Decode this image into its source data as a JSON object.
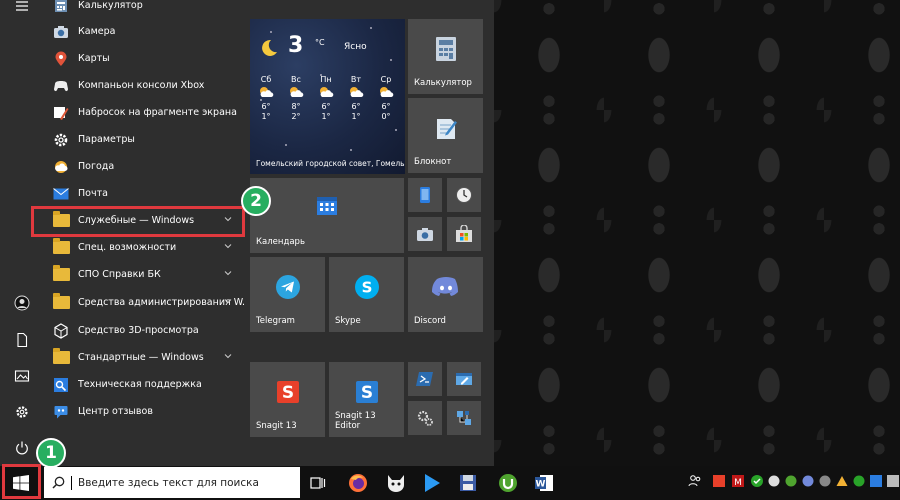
{
  "apps": [
    {
      "label": "Калькулятор",
      "icon": "calculator-icon"
    },
    {
      "label": "Камера",
      "icon": "camera-icon"
    },
    {
      "label": "Карты",
      "icon": "maps-pin-icon"
    },
    {
      "label": "Компаньон консоли Xbox",
      "icon": "xbox-icon"
    },
    {
      "label": "Набросок на фрагменте экрана",
      "icon": "snip-sketch-icon"
    },
    {
      "label": "Параметры",
      "icon": "gear-icon"
    },
    {
      "label": "Погода",
      "icon": "weather-icon"
    },
    {
      "label": "Почта",
      "icon": "mail-icon"
    },
    {
      "label": "Служебные — Windows",
      "icon": "folder-icon",
      "expandable": true
    },
    {
      "label": "Спец. возможности",
      "icon": "folder-icon",
      "expandable": true
    },
    {
      "label": "СПО Справки БК",
      "icon": "folder-icon",
      "expandable": true
    },
    {
      "label": "Средства администрирования W...",
      "icon": "folder-icon",
      "expandable": true
    },
    {
      "label": "Средство 3D-просмотра",
      "icon": "3d-viewer-icon"
    },
    {
      "label": "Стандартные — Windows",
      "icon": "folder-icon",
      "expandable": true
    },
    {
      "label": "Техническая поддержка",
      "icon": "support-icon"
    },
    {
      "label": "Центр отзывов",
      "icon": "feedback-hub-icon"
    }
  ],
  "weather": {
    "temp": "3",
    "unit": "°C",
    "condition": "Ясно",
    "location": "Гомельский городской совет, Гомель",
    "days": [
      {
        "day": "Сб",
        "hi": "6°",
        "lo": "1°"
      },
      {
        "day": "Вс",
        "hi": "8°",
        "lo": "2°"
      },
      {
        "day": "Пн",
        "hi": "6°",
        "lo": "1°"
      },
      {
        "day": "Вт",
        "hi": "6°",
        "lo": "1°"
      },
      {
        "day": "Ср",
        "hi": "6°",
        "lo": "0°"
      }
    ]
  },
  "tiles": {
    "calculator": "Калькулятор",
    "notepad": "Блокнот",
    "calendar": "Календарь",
    "telegram": "Telegram",
    "skype": "Skype",
    "discord": "Discord",
    "snagit": "Snagit 13",
    "snagit_editor_1": "Snagit 13",
    "snagit_editor_2": "Editor"
  },
  "search": {
    "placeholder": "Введите здесь текст для поиска"
  },
  "annotations": {
    "step1": "1",
    "step2": "2"
  },
  "colors": {
    "highlight": "#e0393e",
    "badge": "#27ae60",
    "menu_bg": "#2e2e2e",
    "tile_bg": "#4a4a4a"
  }
}
